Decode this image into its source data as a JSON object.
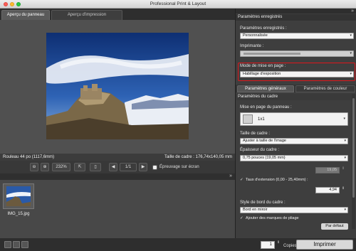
{
  "window": {
    "title": "Professional Print & Layout"
  },
  "left": {
    "tabs": [
      "Aperçu du panneau",
      "Aperçu d'impression"
    ],
    "info_left": "Rouleau 44 po (1117,6mm)",
    "info_right": "Taille de cadre : 176,74x140,05 mm",
    "toolbar": {
      "zoom": "232%",
      "page": "1/1",
      "softproof": "Épreuvage sur écran"
    },
    "thumb_label": "IMG_15.jpg"
  },
  "right": {
    "section_saved": "Paramètres enregistrés",
    "saved_label": "Paramètres enregistrés :",
    "saved_value": "Personnalisée",
    "printer_label": "Imprimante :",
    "printer_value": "",
    "layout_mode_label": "Mode de mise en page :",
    "layout_mode_value": "Habillage d'exposition",
    "subtabs": [
      "Paramètres généraux",
      "Paramètres de couleur"
    ],
    "section_frame": "Paramètres du cadre",
    "panel_layout_label": "Mise en page du panneau :",
    "panel_layout_value": "1x1",
    "frame_size_label": "Taille de cadre :",
    "frame_size_value": "Ajuster à taille de l'image",
    "thickness_label": "Épaisseur du cadre :",
    "thickness_value": "0,75 pouces (19,05 mm)",
    "thickness_num": "19,05",
    "extension_label": "Taux d'extension (0,00 - 25,40mm) :",
    "extension_num": "4,94",
    "edge_style_label": "Style de bord du cadre :",
    "edge_style_value": "Bord en miroir",
    "fold_marks_label": "Ajouter des marques de pliage",
    "default_button": "Par défaut"
  },
  "bottom": {
    "copies": "1",
    "copies_label": "Copies",
    "print_button": "Imprimer"
  }
}
